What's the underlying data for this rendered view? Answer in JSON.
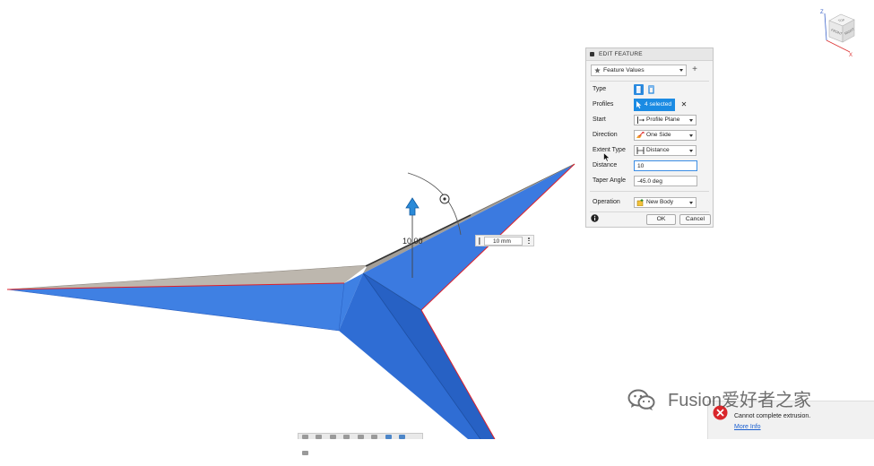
{
  "edit_feature": {
    "title": "EDIT FEATURE",
    "preset": "Feature Values",
    "add_label": "+",
    "rows": {
      "type": {
        "label": "Type",
        "icons": [
          "extrude-solid-icon",
          "extrude-thin-icon"
        ],
        "selected": "extrude-solid-icon"
      },
      "profiles": {
        "label": "Profiles",
        "value": "4 selected",
        "clear": "✕"
      },
      "start": {
        "label": "Start",
        "value": "Profile Plane",
        "icon": "profile-plane-icon"
      },
      "direction": {
        "label": "Direction",
        "value": "One Side",
        "icon": "one-side-icon"
      },
      "extent_type": {
        "label": "Extent Type",
        "value": "Distance",
        "icon": "distance-extent-icon"
      },
      "distance": {
        "label": "Distance",
        "value": "10"
      },
      "taper_angle": {
        "label": "Taper Angle",
        "value": "-45.0 deg"
      },
      "operation": {
        "label": "Operation",
        "value": "New Body",
        "icon": "new-body-icon"
      }
    },
    "ok_label": "OK",
    "cancel_label": "Cancel"
  },
  "viewport": {
    "dimension_label": "10.00",
    "distance_input": "10 mm"
  },
  "view_cube": {
    "top": "TOP",
    "front": "FRONT",
    "right": "RIGHT",
    "axis_z": "Z",
    "axis_x": "X"
  },
  "toast": {
    "message": "Cannot complete extrusion.",
    "link": "More Info"
  },
  "watermark": "Fusion爱好者之家",
  "colors": {
    "accent": "#1b8be3",
    "body_blue": "#3b7ae0",
    "profile_edge": "#e0202a",
    "error": "#d9262b",
    "link": "#1a5fd0"
  }
}
